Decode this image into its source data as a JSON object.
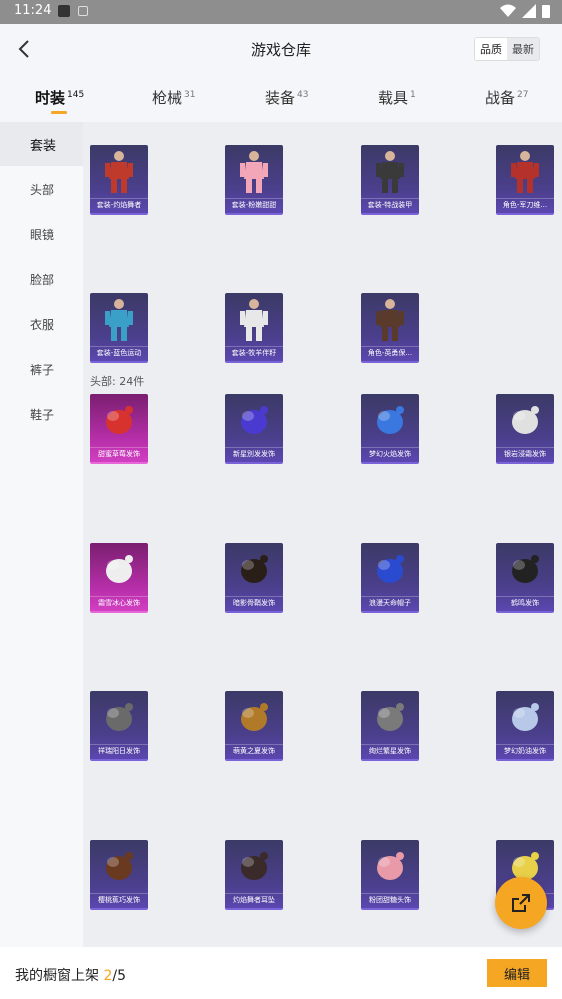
{
  "status_bar": {
    "time": "11:24"
  },
  "header": {
    "title": "游戏仓库",
    "sort_options": [
      "品质",
      "最新"
    ]
  },
  "tabs": [
    {
      "label": "时装",
      "count": "145"
    },
    {
      "label": "枪械",
      "count": "31"
    },
    {
      "label": "装备",
      "count": "43"
    },
    {
      "label": "载具",
      "count": "1"
    },
    {
      "label": "战备",
      "count": "27"
    }
  ],
  "sidebar": {
    "items": [
      "套装",
      "头部",
      "眼镜",
      "脸部",
      "衣服",
      "裤子",
      "鞋子"
    ]
  },
  "sections": [
    {
      "heading": "",
      "items": [
        {
          "name": "套装-灼焰舞者",
          "rarity": "purple",
          "icon": "red-dress-outfit-icon",
          "color": "#c03a2b"
        },
        {
          "name": "套装-粉嫩甜甜",
          "rarity": "purple",
          "icon": "pink-twin-outfit-icon",
          "color": "#f3a6b8"
        },
        {
          "name": "套装-特战装甲",
          "rarity": "purple",
          "icon": "black-armor-outfit-icon",
          "color": "#3a3a3a"
        },
        {
          "name": "角色-军刀维...",
          "rarity": "purple",
          "icon": "red-character-icon",
          "color": "#b5322a"
        },
        {
          "name": "套装-蓝色运动",
          "rarity": "purple",
          "icon": "blue-sport-outfit-icon",
          "color": "#3aa0c8"
        },
        {
          "name": "套装-牧羊伴籽",
          "rarity": "purple",
          "icon": "white-outfit-icon",
          "color": "#e8e8e8"
        },
        {
          "name": "角色-英勇保...",
          "rarity": "purple",
          "icon": "dark-character-icon",
          "color": "#5a3a2a"
        }
      ]
    },
    {
      "heading": "头部: 24件",
      "items": [
        {
          "name": "甜蜜草莓发饰",
          "rarity": "pink",
          "icon": "strawberry-hair-icon",
          "color": "#d8322e"
        },
        {
          "name": "新星別发发饰",
          "rarity": "purple",
          "icon": "blue-clip-hair-icon",
          "color": "#4a3ad0"
        },
        {
          "name": "梦幻火焰发饰",
          "rarity": "purple",
          "icon": "fire-hair-icon",
          "color": "#3a78e0"
        },
        {
          "name": "银岩浸霜发饰",
          "rarity": "purple",
          "icon": "silver-hair-icon",
          "color": "#e0e0e0"
        },
        {
          "name": "霜雪冰心发饰",
          "rarity": "pink",
          "icon": "white-bow-hair-icon",
          "color": "#eeeeee"
        },
        {
          "name": "暗影骨鞘发饰",
          "rarity": "purple",
          "icon": "dark-braid-hair-icon",
          "color": "#2a1e18"
        },
        {
          "name": "浪漫天命帽子",
          "rarity": "purple",
          "icon": "blue-cap-hat-icon",
          "color": "#2a4ad0"
        },
        {
          "name": "鹤鸣发饰",
          "rarity": "purple",
          "icon": "black-bun-hair-icon",
          "color": "#222222"
        },
        {
          "name": "祥瑞阳日发饰",
          "rarity": "purple",
          "icon": "grey-bun-hair-icon",
          "color": "#6a6a6a"
        },
        {
          "name": "萌黄之夏发饰",
          "rarity": "purple",
          "icon": "golden-hair-icon",
          "color": "#b07a28"
        },
        {
          "name": "绚烂繁星发饰",
          "rarity": "purple",
          "icon": "grey-curl-hair-icon",
          "color": "#7a7a7a"
        },
        {
          "name": "梦幻奶油发饰",
          "rarity": "purple",
          "icon": "cream-hair-icon",
          "color": "#b8c8e8"
        },
        {
          "name": "樱桃蕉巧发饰",
          "rarity": "purple",
          "icon": "brown-hair-icon",
          "color": "#6a3a20"
        },
        {
          "name": "灼焰舞者耳坠",
          "rarity": "purple",
          "icon": "earring-icon",
          "color": "#3a2a2a"
        },
        {
          "name": "粉团甜糖头饰",
          "rarity": "purple",
          "icon": "pink-donut-hair-icon",
          "color": "#e89aa8"
        },
        {
          "name": "",
          "rarity": "purple",
          "icon": "yellow-hat-icon",
          "color": "#e8d048"
        }
      ]
    }
  ],
  "bottom_bar": {
    "shelf_label": "我的橱窗上架",
    "shelf_current": "2",
    "shelf_sep": "/",
    "shelf_total": "5",
    "edit_label": "编辑"
  },
  "colors": {
    "accent": "#f5a623",
    "purple_card": "#4b3f8c",
    "pink_card": "#b52ea8"
  }
}
